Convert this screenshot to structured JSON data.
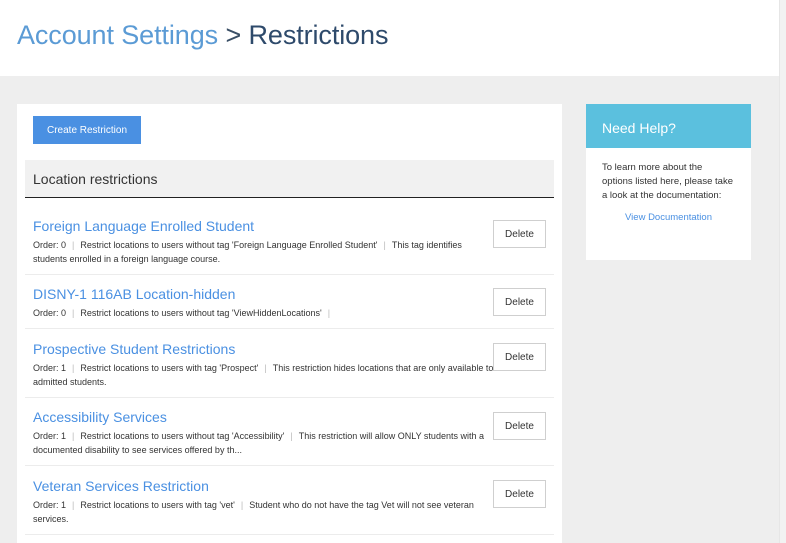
{
  "breadcrumb": {
    "parent": "Account Settings",
    "separator": ">",
    "current": "Restrictions"
  },
  "toolbar": {
    "create_label": "Create Restriction"
  },
  "section": {
    "title": "Location restrictions"
  },
  "restrictions": [
    {
      "title": "Foreign Language Enrolled Student",
      "order": "Order: 0",
      "rule": "Restrict locations to users without tag 'Foreign Language Enrolled Student'",
      "note": "This tag identifies students enrolled in a foreign language course.",
      "delete_label": "Delete"
    },
    {
      "title": "DISNY-1 116AB Location-hidden",
      "order": "Order: 0",
      "rule": "Restrict locations to users without tag 'ViewHiddenLocations'",
      "note": "",
      "delete_label": "Delete"
    },
    {
      "title": "Prospective Student Restrictions",
      "order": "Order: 1",
      "rule": "Restrict locations to users with tag 'Prospect'",
      "note": "This restriction hides locations that are only available to admitted students.",
      "delete_label": "Delete"
    },
    {
      "title": "Accessibility Services",
      "order": "Order: 1",
      "rule": "Restrict locations to users without tag 'Accessibility'",
      "note": "This restriction will allow ONLY students with a documented disability to see services offered by th...",
      "delete_label": "Delete"
    },
    {
      "title": "Veteran Services Restriction",
      "order": "Order: 1",
      "rule": "Restrict locations to users with tag 'vet'",
      "note": "Student who do not have the tag Vet will not see veteran services.",
      "delete_label": "Delete"
    }
  ],
  "help": {
    "title": "Need Help?",
    "text": "To learn more about the options listed here, please take a look at the documentation:",
    "link_label": "View Documentation"
  }
}
